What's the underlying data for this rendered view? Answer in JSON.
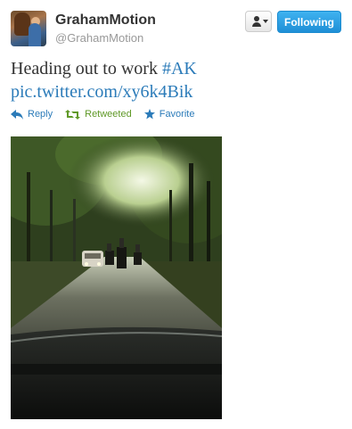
{
  "header": {
    "name": "GrahamMotion",
    "handle": "@GrahamMotion",
    "follow_label": "Following",
    "user_menu_icon": "user-dropdown-icon"
  },
  "tweet": {
    "text_before": "Heading out to work ",
    "hashtag": "#AK",
    "link": "pic.twitter.com/xy6k4Bik"
  },
  "actions": {
    "reply": "Reply",
    "retweeted": "Retweeted",
    "favorite": "Favorite"
  },
  "colors": {
    "link": "#2b7bb9",
    "retweeted": "#609928",
    "follow_button": "#1f8fd6"
  }
}
